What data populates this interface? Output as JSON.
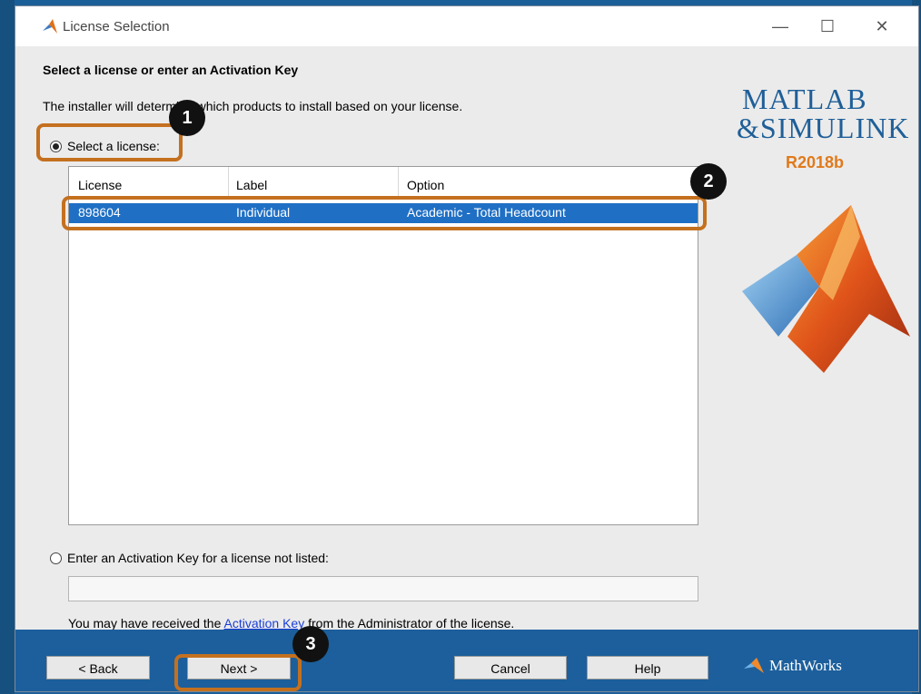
{
  "window": {
    "title": "License Selection"
  },
  "controls": {
    "minimize": "—",
    "maximize": "☐",
    "close": "✕"
  },
  "page": {
    "heading": "Select a license or enter an Activation Key",
    "description": "The installer will determine which products to install based on your license."
  },
  "options": {
    "select_license": {
      "label": "Select a license:",
      "selected": true
    },
    "activation_key": {
      "label": "Enter an Activation Key for a license not listed:",
      "selected": false
    }
  },
  "table": {
    "headers": [
      "License",
      "Label",
      "Option"
    ],
    "rows": [
      [
        "898604",
        "Individual",
        "Academic - Total Headcount"
      ]
    ]
  },
  "activation_input": {
    "value": ""
  },
  "hint": {
    "before": "You may have received the ",
    "link": "Activation Key",
    "after": " from the Administrator of the license."
  },
  "logo": {
    "line1": "MATLAB",
    "line2": "&SIMULINK",
    "release": "R2018b"
  },
  "buttons": {
    "back": "< Back",
    "next": "Next >",
    "cancel": "Cancel",
    "help": "Help"
  },
  "footer": {
    "brand": "MathWorks"
  },
  "callouts": [
    "1",
    "2",
    "3"
  ],
  "colors": {
    "accent": "#1f6fc5",
    "footer": "#1c5f9c",
    "highlight": "#c4701f"
  }
}
